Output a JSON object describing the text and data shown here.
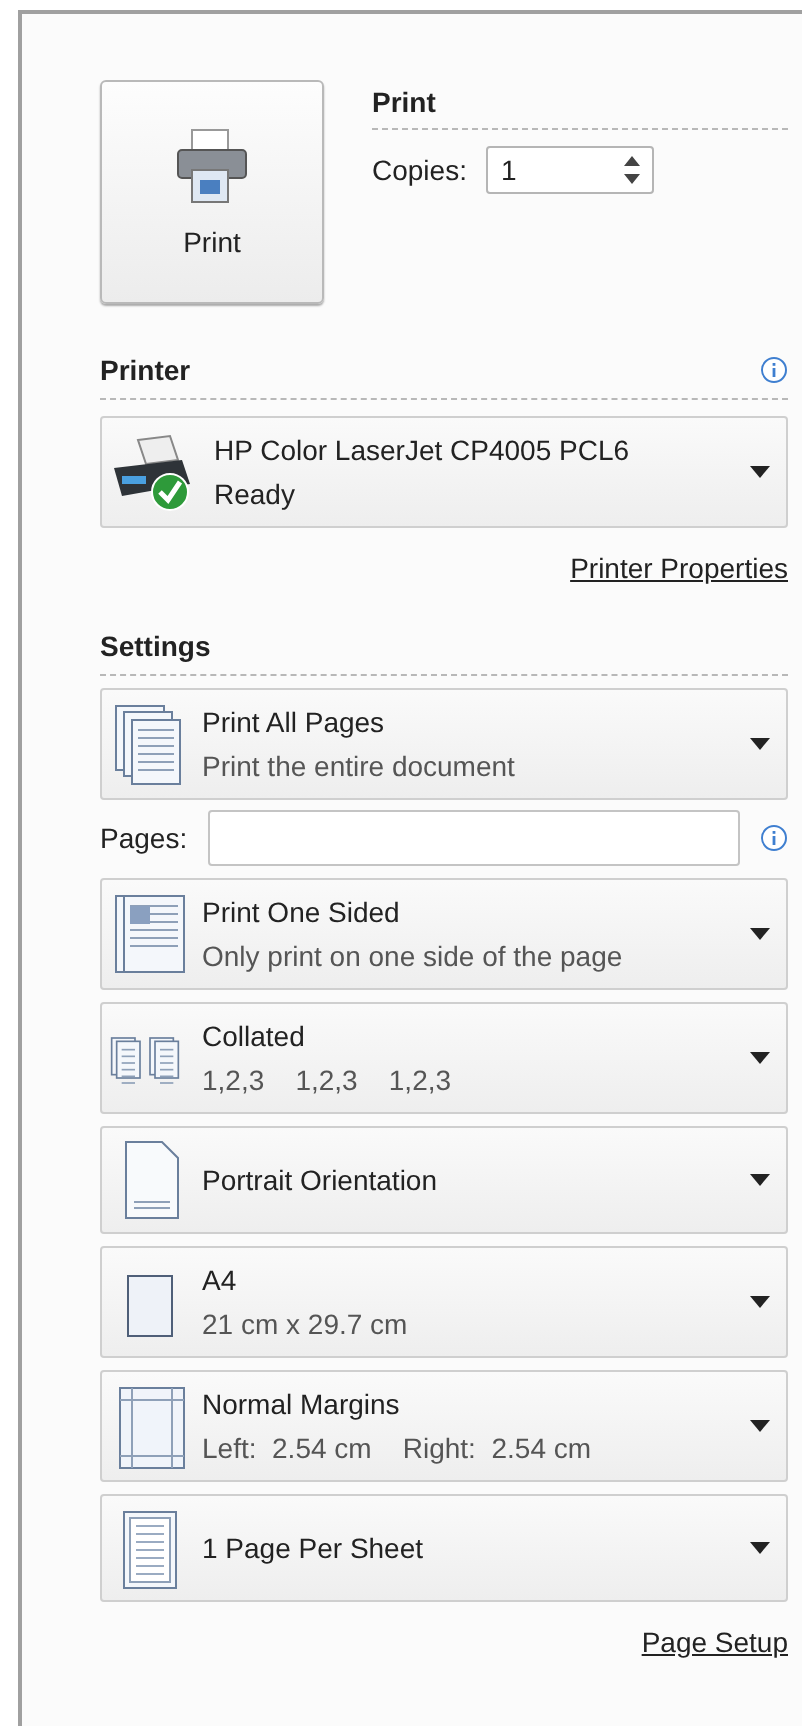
{
  "print_button": {
    "label": "Print"
  },
  "print_section": {
    "title": "Print",
    "copies_label": "Copies:",
    "copies_value": "1"
  },
  "printer": {
    "title": "Printer",
    "name": "HP Color LaserJet CP4005 PCL6",
    "status": "Ready",
    "properties_link": "Printer Properties"
  },
  "settings": {
    "title": "Settings",
    "pages_label": "Pages:",
    "items": [
      {
        "kind": "pages",
        "title": "Print All Pages",
        "subtitle": "Print the entire document"
      },
      {
        "kind": "sided",
        "title": "Print One Sided",
        "subtitle": "Only print on one side of the page"
      },
      {
        "kind": "collated",
        "title": "Collated",
        "subtitle": "1,2,3    1,2,3    1,2,3"
      },
      {
        "kind": "orientation",
        "title": "Portrait Orientation"
      },
      {
        "kind": "paper",
        "title": "A4",
        "subtitle": "21 cm x 29.7 cm"
      },
      {
        "kind": "margins",
        "title": "Normal Margins",
        "subtitle": "Left:  2.54 cm    Right:  2.54 cm"
      },
      {
        "kind": "persheet",
        "title": "1 Page Per Sheet"
      }
    ],
    "page_setup_link": "Page Setup"
  }
}
